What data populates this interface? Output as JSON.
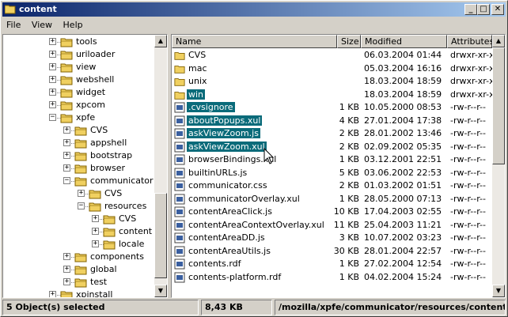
{
  "window": {
    "title": "content"
  },
  "menu": [
    {
      "label": "File"
    },
    {
      "label": "View"
    },
    {
      "label": "Help"
    }
  ],
  "tree": [
    {
      "label": "tools",
      "depth": 2,
      "exp": "+"
    },
    {
      "label": "uriloader",
      "depth": 2,
      "exp": "+"
    },
    {
      "label": "view",
      "depth": 2,
      "exp": "+"
    },
    {
      "label": "webshell",
      "depth": 2,
      "exp": "+"
    },
    {
      "label": "widget",
      "depth": 2,
      "exp": "+"
    },
    {
      "label": "xpcom",
      "depth": 2,
      "exp": "+"
    },
    {
      "label": "xpfe",
      "depth": 2,
      "exp": "-"
    },
    {
      "label": "CVS",
      "depth": 3,
      "exp": "+"
    },
    {
      "label": "appshell",
      "depth": 3,
      "exp": "+"
    },
    {
      "label": "bootstrap",
      "depth": 3,
      "exp": "+"
    },
    {
      "label": "browser",
      "depth": 3,
      "exp": "+"
    },
    {
      "label": "communicator",
      "depth": 3,
      "exp": "-"
    },
    {
      "label": "CVS",
      "depth": 4,
      "exp": "+"
    },
    {
      "label": "resources",
      "depth": 4,
      "exp": "-"
    },
    {
      "label": "CVS",
      "depth": 5,
      "exp": "+"
    },
    {
      "label": "content",
      "depth": 5,
      "exp": "+"
    },
    {
      "label": "locale",
      "depth": 5,
      "exp": "+"
    },
    {
      "label": "components",
      "depth": 3,
      "exp": "+"
    },
    {
      "label": "global",
      "depth": 3,
      "exp": "+"
    },
    {
      "label": "test",
      "depth": 3,
      "exp": "+"
    },
    {
      "label": "xpinstall",
      "depth": 2,
      "exp": "+"
    }
  ],
  "columns": {
    "name": "Name",
    "size": "Size",
    "modified": "Modified",
    "attributes": "Attributes"
  },
  "files": [
    {
      "name": "CVS",
      "size": "",
      "modified": "06.03.2004 01:44",
      "attr": "drwxr-xr-x",
      "type": "folder",
      "sel": false
    },
    {
      "name": "mac",
      "size": "",
      "modified": "05.03.2004 16:16",
      "attr": "drwxr-xr-x",
      "type": "folder",
      "sel": false
    },
    {
      "name": "unix",
      "size": "",
      "modified": "18.03.2004 18:59",
      "attr": "drwxr-xr-x",
      "type": "folder",
      "sel": false
    },
    {
      "name": "win",
      "size": "",
      "modified": "18.03.2004 18:59",
      "attr": "drwxr-xr-x",
      "type": "folder",
      "sel": true
    },
    {
      "name": ".cvsignore",
      "size": "1 KB",
      "modified": "10.05.2000 08:53",
      "attr": "-rw-r--r--",
      "type": "file",
      "sel": true
    },
    {
      "name": "aboutPopups.xul",
      "size": "4 KB",
      "modified": "27.01.2004 17:38",
      "attr": "-rw-r--r--",
      "type": "file",
      "sel": true
    },
    {
      "name": "askViewZoom.js",
      "size": "2 KB",
      "modified": "28.01.2002 13:46",
      "attr": "-rw-r--r--",
      "type": "file",
      "sel": true
    },
    {
      "name": "askViewZoom.xul",
      "size": "2 KB",
      "modified": "02.09.2002 05:35",
      "attr": "-rw-r--r--",
      "type": "file",
      "sel": true
    },
    {
      "name": "browserBindings.xul",
      "size": "1 KB",
      "modified": "03.12.2001 22:51",
      "attr": "-rw-r--r--",
      "type": "file",
      "sel": false
    },
    {
      "name": "builtinURLs.js",
      "size": "5 KB",
      "modified": "03.06.2002 22:53",
      "attr": "-rw-r--r--",
      "type": "file",
      "sel": false
    },
    {
      "name": "communicator.css",
      "size": "2 KB",
      "modified": "01.03.2002 01:51",
      "attr": "-rw-r--r--",
      "type": "file",
      "sel": false
    },
    {
      "name": "communicatorOverlay.xul",
      "size": "1 KB",
      "modified": "28.05.2000 07:13",
      "attr": "-rw-r--r--",
      "type": "file",
      "sel": false
    },
    {
      "name": "contentAreaClick.js",
      "size": "10 KB",
      "modified": "17.04.2003 02:55",
      "attr": "-rw-r--r--",
      "type": "file",
      "sel": false
    },
    {
      "name": "contentAreaContextOverlay.xul",
      "size": "11 KB",
      "modified": "25.04.2003 11:21",
      "attr": "-rw-r--r--",
      "type": "file",
      "sel": false
    },
    {
      "name": "contentAreaDD.js",
      "size": "3 KB",
      "modified": "10.07.2002 03:23",
      "attr": "-rw-r--r--",
      "type": "file",
      "sel": false
    },
    {
      "name": "contentAreaUtils.js",
      "size": "30 KB",
      "modified": "28.01.2004 22:57",
      "attr": "-rw-r--r--",
      "type": "file",
      "sel": false
    },
    {
      "name": "contents.rdf",
      "size": "1 KB",
      "modified": "27.02.2004 12:54",
      "attr": "-rw-r--r--",
      "type": "file",
      "sel": false
    },
    {
      "name": "contents-platform.rdf",
      "size": "1 KB",
      "modified": "04.02.2004 15:24",
      "attr": "-rw-r--r--",
      "type": "file",
      "sel": false
    }
  ],
  "status": {
    "selection": "5 Object(s) selected",
    "size": "8,43 KB",
    "path": "/mozilla/xpfe/communicator/resources/content"
  },
  "colors": {
    "selection": "#0a6b7a",
    "folder": "#f0d060",
    "titlebar": "#0a246a"
  }
}
